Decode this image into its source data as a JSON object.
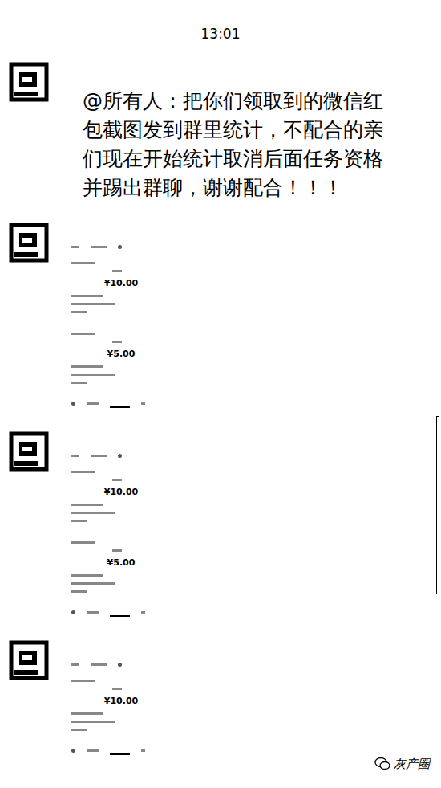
{
  "time": "13:01",
  "messages": [
    {
      "kind": "text",
      "text": "@所有人：把你们领取到的微信红包截图发到群里统计，不配合的亲们现在开始统计取消后面任务资格并踢出群聊，谢谢配合！！！"
    },
    {
      "kind": "screenshot",
      "amounts": [
        "¥10.00",
        "¥5.00"
      ]
    },
    {
      "kind": "screenshot",
      "amounts": [
        "¥10.00",
        "¥5.00"
      ]
    },
    {
      "kind": "screenshot",
      "amounts": [
        "¥10.00"
      ]
    }
  ],
  "watermark": {
    "text": "灰产圈"
  }
}
